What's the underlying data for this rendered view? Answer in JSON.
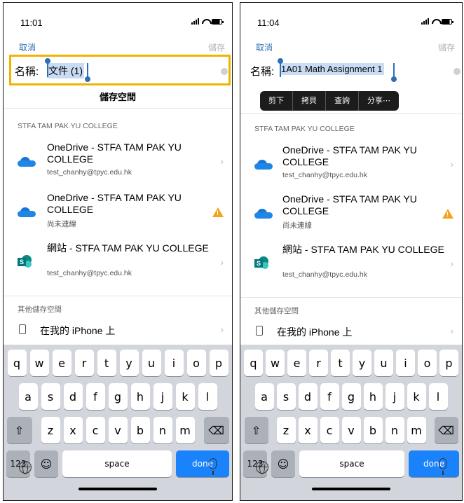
{
  "left": {
    "time": "11:01",
    "cancel": "取消",
    "save": "儲存",
    "name_label": "名稱:",
    "name_value": "文件 (1)",
    "storage_heading": "儲存空間",
    "org_section": "STFA TAM PAK YU COLLEGE",
    "items": [
      {
        "title": "OneDrive - STFA TAM PAK YU COLLEGE",
        "sub": "test_chanhy@tpyc.edu.hk",
        "icon": "onedrive-icon"
      },
      {
        "title": "OneDrive - STFA TAM PAK YU COLLEGE",
        "sub": "尚未連線",
        "icon": "onedrive-icon"
      },
      {
        "title": "網站 - STFA TAM PAK YU COLLEGE",
        "sub": "test_chanhy@tpyc.edu.hk",
        "icon": "sharepoint-icon"
      }
    ],
    "other_section": "其他儲存空間",
    "iphone": "在我的 iPhone 上"
  },
  "right": {
    "time": "11:04",
    "cancel": "取消",
    "save": "儲存",
    "name_label": "名稱:",
    "name_value": "1A01 Math Assignment 1",
    "menu": [
      "剪下",
      "拷貝",
      "查詢",
      "分享⋯"
    ],
    "org_section": "STFA TAM PAK YU COLLEGE",
    "items": [
      {
        "title": "OneDrive - STFA TAM PAK YU COLLEGE",
        "sub": "test_chanhy@tpyc.edu.hk",
        "icon": "onedrive-icon"
      },
      {
        "title": "OneDrive - STFA TAM PAK YU COLLEGE",
        "sub": "尚未連線",
        "icon": "onedrive-icon"
      },
      {
        "title": "網站 - STFA TAM PAK YU COLLEGE",
        "sub": "test_chanhy@tpyc.edu.hk",
        "icon": "sharepoint-icon"
      }
    ],
    "other_section": "其他儲存空間",
    "iphone": "在我的 iPhone 上"
  },
  "keyboard": {
    "row1": [
      "q",
      "w",
      "e",
      "r",
      "t",
      "y",
      "u",
      "i",
      "o",
      "p"
    ],
    "row2": [
      "a",
      "s",
      "d",
      "f",
      "g",
      "h",
      "j",
      "k",
      "l"
    ],
    "row3": [
      "z",
      "x",
      "c",
      "v",
      "b",
      "n",
      "m"
    ],
    "shift": "⇧",
    "backspace": "⌫",
    "num": "123",
    "emoji": "☺",
    "space": "space",
    "done": "done"
  },
  "colors": {
    "accent": "#2f6fb5",
    "highlight": "#f0b400",
    "done": "#1a82fb",
    "warn": "#f4a41c"
  }
}
